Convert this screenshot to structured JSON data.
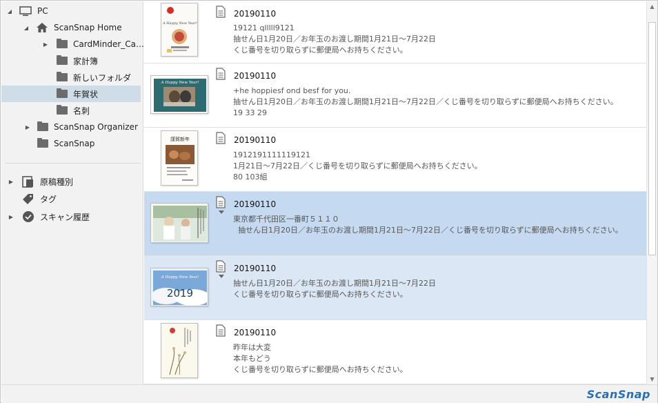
{
  "sidebar": {
    "pc": "PC",
    "scansnap_home": "ScanSnap Home",
    "folders": [
      {
        "label": "CardMinder_Ca…"
      },
      {
        "label": "家計簿"
      },
      {
        "label": "新しいフォルダ"
      },
      {
        "label": "年賀状"
      },
      {
        "label": "名刺"
      }
    ],
    "scansnap_organizer": "ScanSnap Organizer",
    "scansnap": "ScanSnap",
    "doc_type": "原稿種別",
    "tag": "タグ",
    "scan_history": "スキャン履歴"
  },
  "list": {
    "items": [
      {
        "date": "20190110",
        "lines": [
          "19121  qlllll9121",
          "抽せん日1月20日／お年玉のお渡し期間1月21日～7月22日",
          "くじ番号を切り取らずに郵便局へお持ちください。"
        ]
      },
      {
        "date": "20190110",
        "lines": [
          "+he hoppiesf ond besf for you.",
          "抽せん日1月20日／お年玉のお渡し期間1月21日～7月22日／くじ番号を切り取らずに郵便局へお持ちください。",
          "19 33 29"
        ]
      },
      {
        "date": "20190110",
        "lines": [
          "1912191111119121",
          "1月21日～7月22日／くじ番号を切り取らずに郵便局へお持ちください。",
          "80 103組"
        ]
      },
      {
        "date": "20190110",
        "lines": [
          "東京都千代田区一番町５１１０",
          "  抽せん日1月20日／お年玉のお渡し期間1月21日～7月22日／くじ番号を切り取らずに郵便局へお持ちください。"
        ]
      },
      {
        "date": "20190110",
        "lines": [
          "抽せん日1月20日／お年玉のお渡し期間1月21日～7月22日",
          "くじ番号を切り取らずに郵便局へお持ちください。"
        ]
      },
      {
        "date": "20190110",
        "lines": [
          "昨年は大変",
          "本年もどう",
          "くじ番号を切り取らずに郵便局へお持ちください。"
        ]
      }
    ],
    "thumb_texts": {
      "card1": "A Happy New Year!",
      "card2": "A Happy New Year!",
      "card3": "謹賀新年",
      "card5_title": "A Happy New Year!",
      "card5_year": "2019"
    }
  },
  "footer": {
    "brand": "ScanSnap"
  },
  "colors": {
    "selected_row": "#c5daf1",
    "hover_row": "#dbe7f4",
    "sidebar_selected": "#cfdde9",
    "brand": "#2a6fb3"
  }
}
